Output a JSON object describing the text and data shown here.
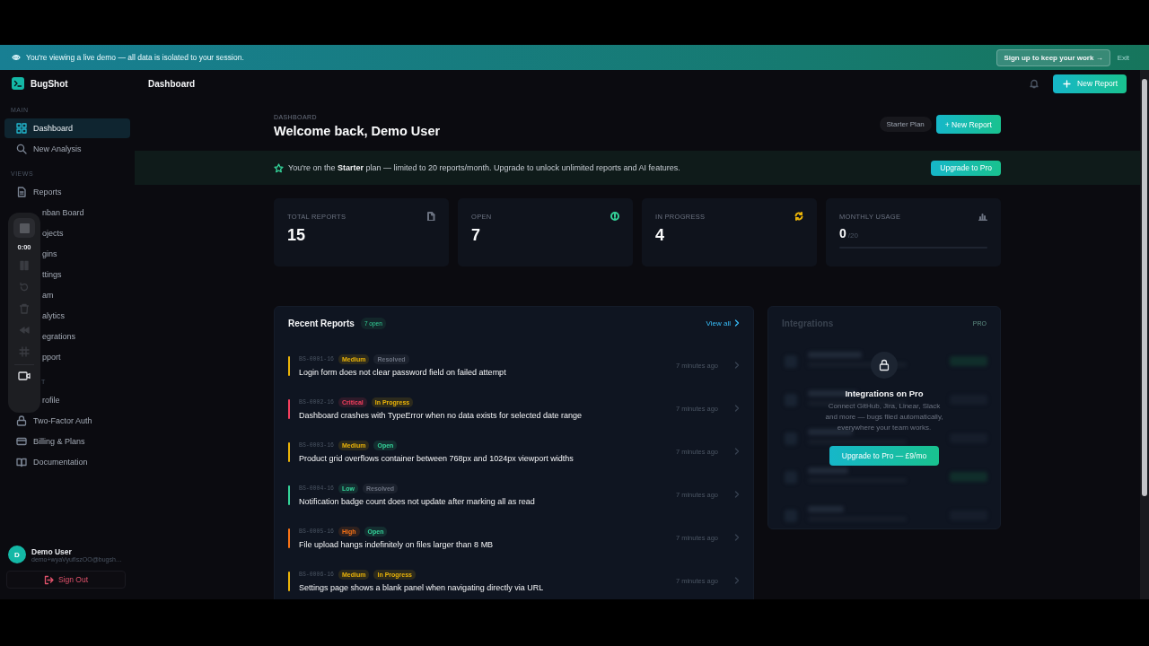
{
  "demo_banner": {
    "text": "You're viewing a live demo — all data is isolated to your session.",
    "signup": "Sign up to keep your work →",
    "exit": "Exit"
  },
  "sidebar": {
    "brand": "BugShot",
    "sections": [
      {
        "label": "MAIN",
        "kind": "full",
        "items": [
          {
            "label": "Dashboard",
            "kind": "full",
            "selected": true
          },
          {
            "label": "New Analysis",
            "kind": "full",
            "selected": false
          }
        ]
      },
      {
        "label": "VIEWS",
        "kind": "full",
        "items": [
          {
            "label": "Reports",
            "kind": "full",
            "selected": false
          },
          {
            "label": "nban Board",
            "kind": "covered",
            "selected": false
          },
          {
            "label": "ojects",
            "kind": "covered",
            "selected": false
          },
          {
            "label": "gins",
            "kind": "covered",
            "selected": false
          },
          {
            "label": "ttings",
            "kind": "covered",
            "selected": false
          },
          {
            "label": "am",
            "kind": "covered",
            "selected": false
          },
          {
            "label": "alytics",
            "kind": "covered",
            "selected": false
          },
          {
            "label": "egrations",
            "kind": "covered",
            "selected": false
          },
          {
            "label": "pport",
            "kind": "covered",
            "selected": false
          }
        ]
      },
      {
        "label": "T",
        "kind": "covered",
        "items": [
          {
            "label": "rofile",
            "kind": "covered",
            "selected": false
          },
          {
            "label": "Two-Factor Auth",
            "kind": "full",
            "selected": false
          },
          {
            "label": "Billing & Plans",
            "kind": "full",
            "selected": false
          },
          {
            "label": "Documentation",
            "kind": "full",
            "selected": false
          }
        ]
      }
    ],
    "user": {
      "initial": "D",
      "name": "Demo User",
      "email": "demo+wyaVyufIszOO@bugsh…"
    },
    "sign_out": "Sign Out"
  },
  "recorder": {
    "time": "0:00"
  },
  "topbar": {
    "title": "Dashboard",
    "new_report": "New Report"
  },
  "page": {
    "eyebrow": "DASHBOARD",
    "heading": "Welcome back, Demo User",
    "plan_badge": "Starter Plan",
    "new_report": "+ New Report"
  },
  "plan_notice": {
    "text": "You're on the **Starter** plan — limited to 20 reports/month. Upgrade to unlock unlimited reports and AI features.",
    "button": "Upgrade to Pro"
  },
  "stats": [
    {
      "kind": "count",
      "label": "TOTAL REPORTS",
      "value": "15",
      "color": "#6b7280"
    },
    {
      "kind": "count",
      "label": "OPEN",
      "value": "7",
      "color": "#34d399"
    },
    {
      "kind": "count",
      "label": "IN PROGRESS",
      "value": "4",
      "color": "#eab308"
    },
    {
      "kind": "usage",
      "label": "MONTHLY USAGE",
      "value": "0",
      "total": "/20",
      "level": 0,
      "color": "#6b7280"
    }
  ],
  "recent_reports": {
    "title": "Recent Reports",
    "badge": "7 open",
    "view_all": "View all",
    "items": [
      {
        "id": "BS-0001-16",
        "severity": "Medium",
        "color": "#eab308",
        "status": {
          "label": "Resolved",
          "color": "#6b7280"
        },
        "title": "Login form does not clear password field on failed attempt",
        "time": "7 minutes ago"
      },
      {
        "id": "BS-0002-16",
        "severity": "Critical",
        "color": "#f43f5e",
        "status": {
          "label": "In Progress",
          "color": "#eab308"
        },
        "title": "Dashboard crashes with TypeError when no data exists for selected date range",
        "time": "7 minutes ago"
      },
      {
        "id": "BS-0003-16",
        "severity": "Medium",
        "color": "#eab308",
        "status": {
          "label": "Open",
          "color": "#34d399"
        },
        "title": "Product grid overflows container between 768px and 1024px viewport widths",
        "time": "7 minutes ago"
      },
      {
        "id": "BS-0004-16",
        "severity": "Low",
        "color": "#34d399",
        "status": {
          "label": "Resolved",
          "color": "#6b7280"
        },
        "title": "Notification badge count does not update after marking all as read",
        "time": "7 minutes ago"
      },
      {
        "id": "BS-0005-16",
        "severity": "High",
        "color": "#f97316",
        "status": {
          "label": "Open",
          "color": "#34d399"
        },
        "title": "File upload hangs indefinitely on files larger than 8 MB",
        "time": "7 minutes ago"
      },
      {
        "id": "BS-0006-16",
        "severity": "Medium",
        "color": "#eab308",
        "status": {
          "label": "In Progress",
          "color": "#eab308"
        },
        "title": "Settings page shows a blank panel when navigating directly via URL",
        "time": "7 minutes ago"
      }
    ]
  },
  "integrations": {
    "title": "Integrations",
    "badge": "PRO",
    "lock_title": "Integrations on Pro",
    "lock_text": "Connect GitHub, Jira, Linear, Slack and more — bugs filed automatically, everywhere your team works.",
    "button": "Upgrade to Pro — £9/mo"
  }
}
